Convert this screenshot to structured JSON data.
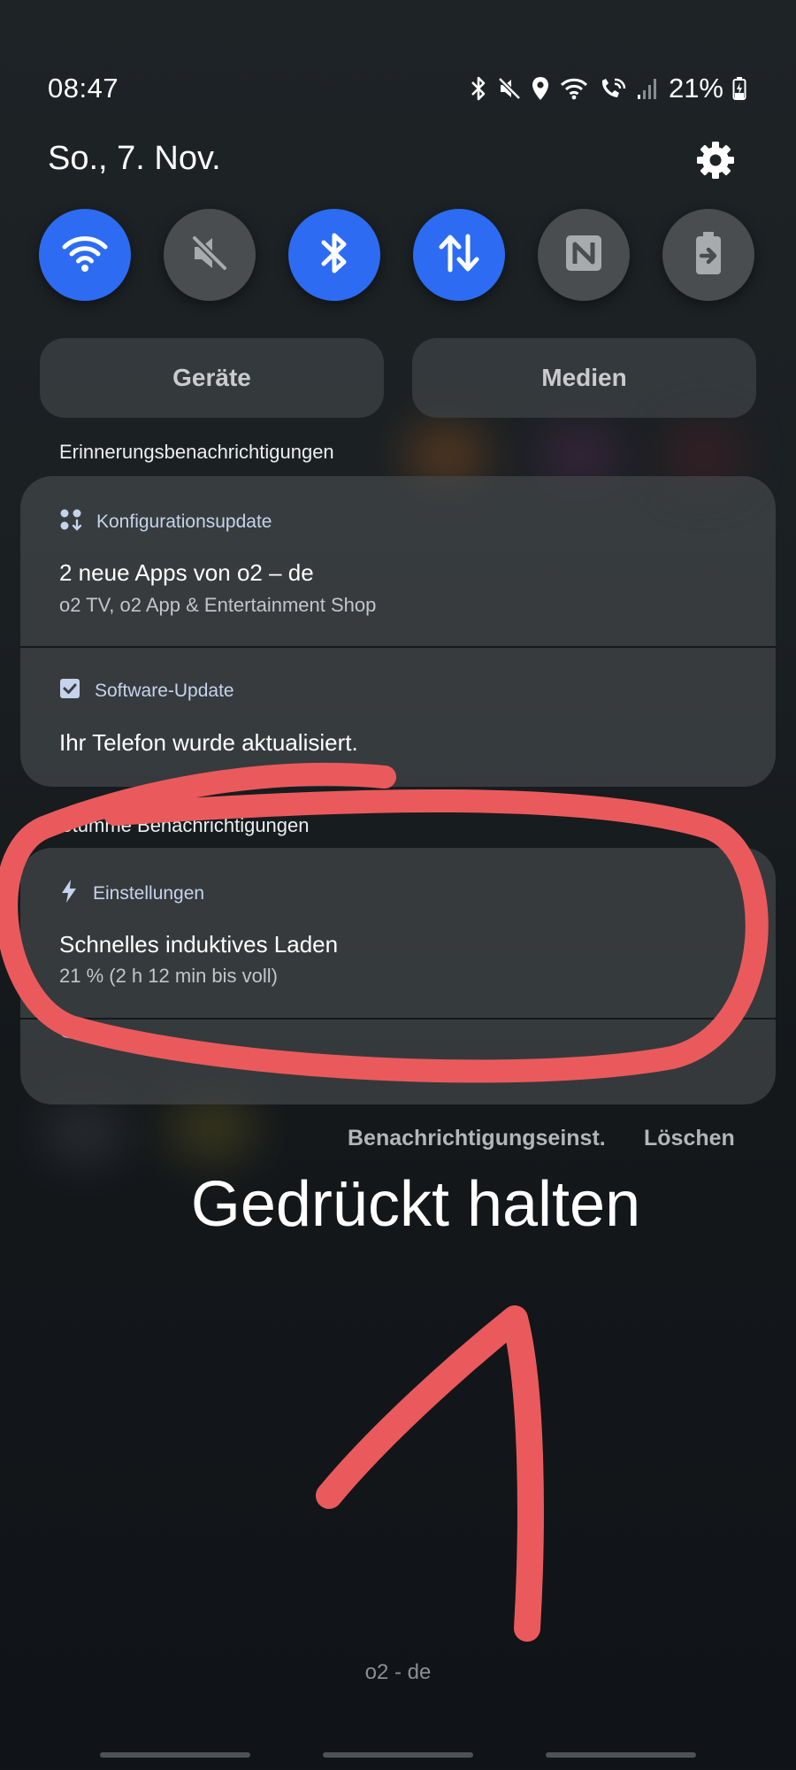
{
  "status_bar": {
    "time": "08:47",
    "battery_percent": "21%",
    "icons": [
      "bluetooth-icon",
      "mute-icon",
      "location-icon",
      "wifi-icon",
      "wifi-calling-icon",
      "signal-icon",
      "battery-charging-icon"
    ]
  },
  "header": {
    "date": "So., 7. Nov.",
    "settings_icon": "gear-icon"
  },
  "quick_toggles": [
    {
      "name": "wifi",
      "icon": "wifi-icon",
      "state": "on"
    },
    {
      "name": "sound",
      "icon": "mute-icon",
      "state": "off"
    },
    {
      "name": "bluetooth",
      "icon": "bluetooth-icon",
      "state": "on"
    },
    {
      "name": "mobile-data",
      "icon": "data-arrows-icon",
      "state": "on"
    },
    {
      "name": "nfc",
      "icon": "nfc-icon",
      "state": "off"
    },
    {
      "name": "power-share",
      "icon": "power-share-icon",
      "state": "off"
    }
  ],
  "panel_buttons": {
    "devices": "Geräte",
    "media": "Medien"
  },
  "sections": {
    "reminders": "Erinnerungsbenachrichtigungen",
    "silent": "Stumme Benachrichtigungen"
  },
  "notifications": [
    {
      "app": "Konfigurationsupdate",
      "icon": "config-update-icon",
      "title": "2 neue Apps von o2 – de",
      "text": "o2 TV, o2 App & Entertainment Shop"
    },
    {
      "app": "Software-Update",
      "icon": "checkbox-icon",
      "title": "Ihr Telefon wurde aktualisiert.",
      "text": ""
    },
    {
      "app": "Einstellungen",
      "icon": "lightning-icon",
      "title": "Schnelles induktives Laden",
      "text": "21 % (2 h 12 min bis voll)"
    }
  ],
  "actions": {
    "notification_settings": "Benachrichtigungseinst.",
    "clear": "Löschen"
  },
  "overlay_text": "Gedrückt halten",
  "carrier": "o2 - de",
  "colors": {
    "accent_blue": "#2d6cf2",
    "annotation_red": "#ea5a5c"
  }
}
